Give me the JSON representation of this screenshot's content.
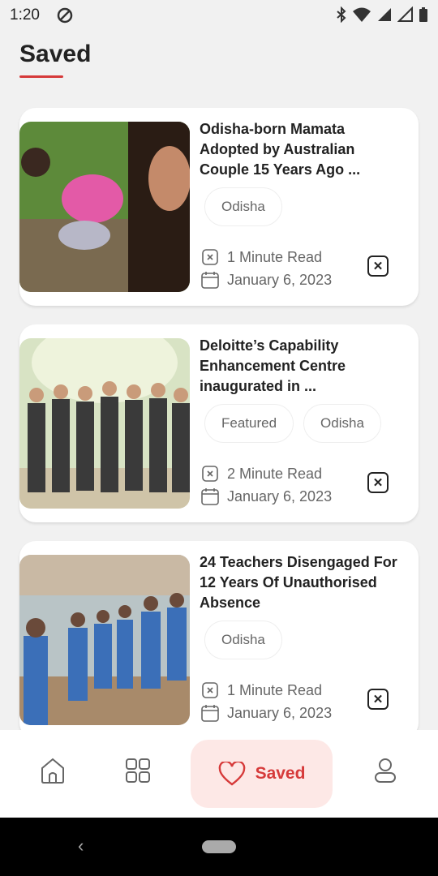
{
  "status_bar": {
    "time": "1:20"
  },
  "page": {
    "title": "Saved"
  },
  "articles": [
    {
      "title": "Odisha-born Mamata Adopted by Australian Couple 15 Years Ago ...",
      "tags": [
        "Odisha"
      ],
      "read_time": "1 Minute Read",
      "date": "January 6, 2023"
    },
    {
      "title": "Deloitte’s Capability Enhancement Centre inaugurated in ...",
      "tags": [
        "Featured",
        "Odisha"
      ],
      "read_time": "2 Minute Read",
      "date": "January 6, 2023"
    },
    {
      "title": "24 Teachers Disengaged For 12 Years Of Unauthorised Absence",
      "tags": [
        "Odisha"
      ],
      "read_time": "1 Minute Read",
      "date": "January 6, 2023"
    }
  ],
  "bottom_nav": {
    "items": [
      "home-icon",
      "grid-icon",
      "saved-heart-icon",
      "profile-icon"
    ],
    "saved_label": "Saved",
    "accent": "#d63a3a"
  }
}
